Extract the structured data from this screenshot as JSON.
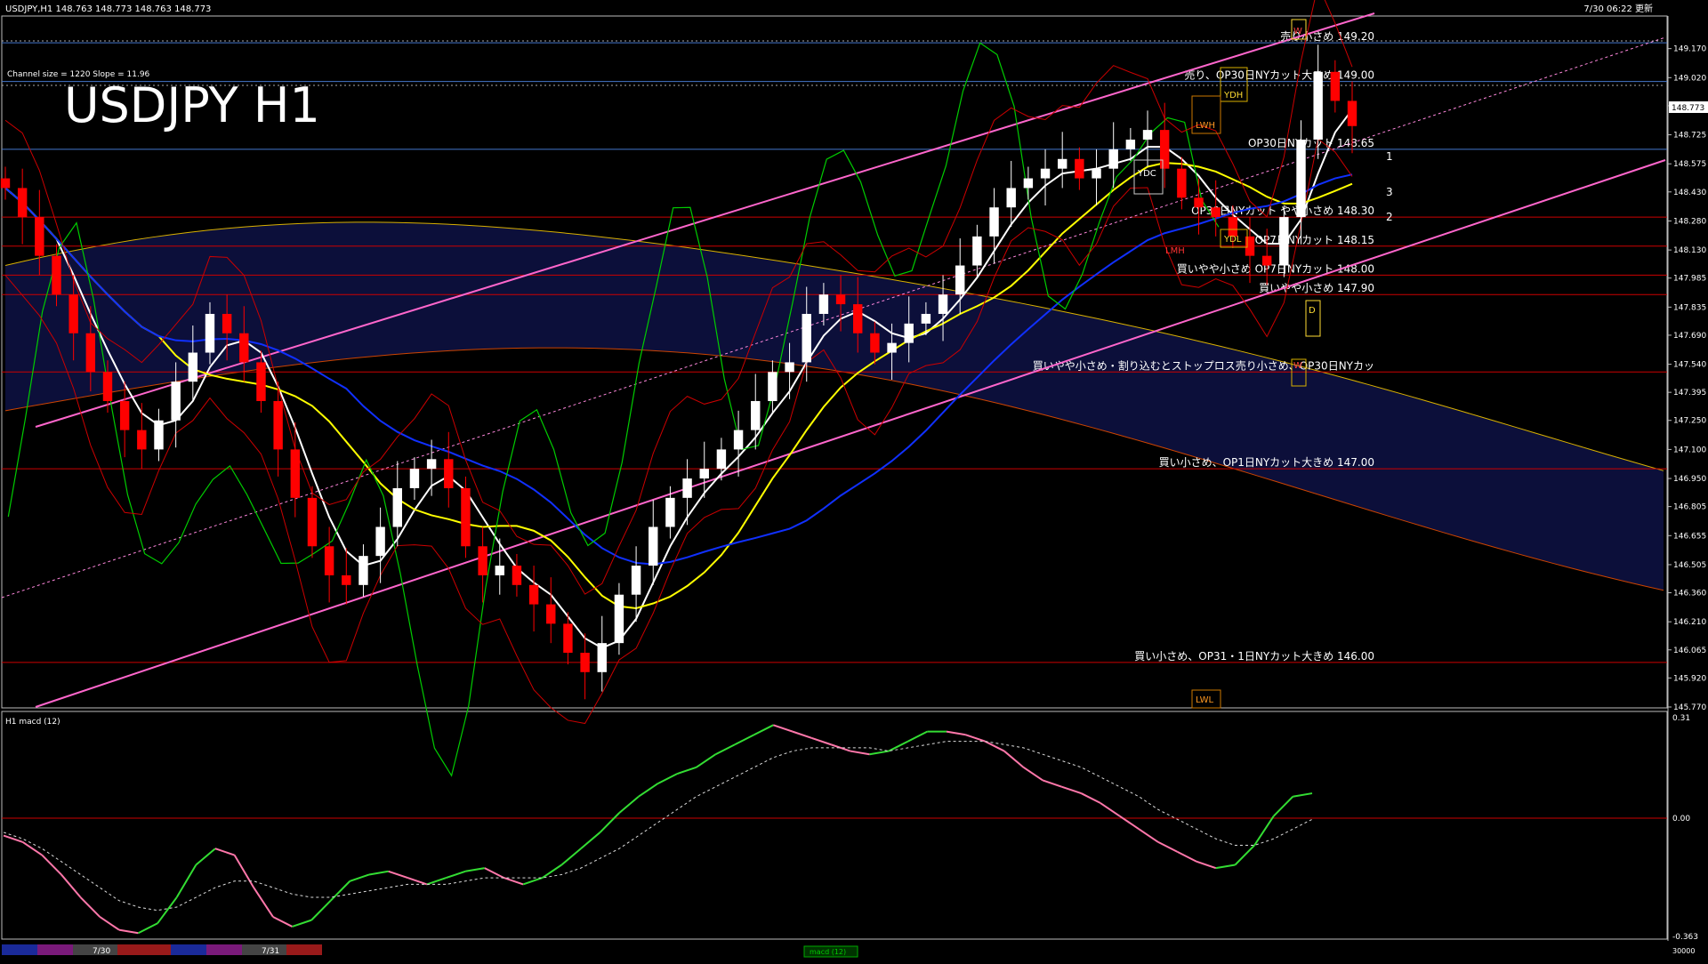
{
  "header": {
    "symbol_info": "USDJPY,H1  148.763 148.773 148.763 148.773",
    "channel_info": "Channel size = 1220 Slope = 11.96",
    "big_title": "USDJPY H1",
    "timestamp": "7/30 06:22 更新"
  },
  "price_axis": {
    "labels": [
      "149.170",
      "149.020",
      "148.875",
      "148.725",
      "148.575",
      "148.430",
      "148.280",
      "148.130",
      "147.985",
      "147.835",
      "147.690",
      "147.540",
      "147.395",
      "147.250",
      "147.100",
      "146.950",
      "146.805",
      "146.655",
      "146.505",
      "146.360",
      "146.210",
      "146.065",
      "145.920",
      "145.770"
    ],
    "current_price": "148.773"
  },
  "levels": [
    {
      "text": "売り小さめ 149.20",
      "value": 149.2
    },
    {
      "text": "売り、OP30日NYカット大きめ 149.00",
      "value": 149.0
    },
    {
      "text": "OP30日NYカット 148.65",
      "value": 148.65
    },
    {
      "text": "OP30日NYカット やや小さめ 148.30",
      "value": 148.3
    },
    {
      "text": "OP7日NYカット 148.15",
      "value": 148.15
    },
    {
      "text": "買いやや小さめ OP7日NYカット 148.00",
      "value": 148.0
    },
    {
      "text": "買いやや小さめ 147.90",
      "value": 147.9
    },
    {
      "text": "買いやや小さめ・割り込むとストップロス売り小さめ、OP30日NYカッ",
      "value": 147.5
    },
    {
      "text": "買い小さめ、OP1日NYカット大きめ 147.00",
      "value": 147.0
    },
    {
      "text": "買い小さめ、OP31・1日NYカット大きめ 146.00",
      "value": 146.0
    }
  ],
  "channel_labels": [
    "1",
    "3",
    "2"
  ],
  "box_labels": [
    "YDH",
    "YDC",
    "YDL",
    "LWH",
    "LWL",
    "LMH",
    "D",
    "W",
    "W"
  ],
  "macd": {
    "title": "H1  macd (12)",
    "axis_labels": [
      "0.31",
      "0.00",
      "-0.363"
    ]
  },
  "bottom_bar": {
    "dates": [
      "7/30",
      "7/31"
    ],
    "tab_label": "macd (12)",
    "right_label": "30000"
  },
  "colors": {
    "background": "#000000",
    "bull_candle": "#ffffff",
    "bear_candle": "#ff0000",
    "ma_white": "#ffffff",
    "ma_yellow": "#ffff00",
    "ma_blue": "#1030ff",
    "channel": "#ff66cc",
    "level_line": "#cc0000",
    "chikou": "#00cc00",
    "macd_up": "#33dd33",
    "macd_down": "#ff77aa"
  },
  "chart_data": {
    "type": "candlestick",
    "symbol": "USDJPY",
    "timeframe": "H1",
    "ylim": [
      145.77,
      149.32
    ],
    "current_price": 148.773,
    "price_series": [
      148.45,
      148.3,
      148.1,
      147.9,
      147.7,
      147.5,
      147.35,
      147.2,
      147.1,
      147.25,
      147.45,
      147.6,
      147.8,
      147.7,
      147.55,
      147.35,
      147.1,
      146.85,
      146.6,
      146.45,
      146.4,
      146.55,
      146.7,
      146.9,
      147.0,
      147.05,
      146.9,
      146.6,
      146.45,
      146.5,
      146.4,
      146.3,
      146.2,
      146.05,
      145.95,
      146.1,
      146.35,
      146.5,
      146.7,
      146.85,
      146.95,
      147.0,
      147.1,
      147.2,
      147.35,
      147.5,
      147.55,
      147.8,
      147.9,
      147.85,
      147.7,
      147.6,
      147.65,
      147.75,
      147.8,
      147.9,
      148.05,
      148.2,
      148.35,
      148.45,
      148.5,
      148.55,
      148.6,
      148.5,
      148.55,
      148.65,
      148.7,
      148.75,
      148.55,
      148.4,
      148.35,
      148.3,
      148.2,
      148.1,
      148.05,
      148.3,
      148.7,
      149.05,
      148.9,
      148.77
    ],
    "macd_ylim": [
      -0.363,
      0.31
    ],
    "macd_series": [
      -0.05,
      -0.07,
      -0.11,
      -0.17,
      -0.24,
      -0.3,
      -0.34,
      -0.35,
      -0.32,
      -0.24,
      -0.14,
      -0.09,
      -0.11,
      -0.21,
      -0.3,
      -0.33,
      -0.31,
      -0.25,
      -0.19,
      -0.17,
      -0.16,
      -0.18,
      -0.2,
      -0.18,
      -0.16,
      -0.15,
      -0.18,
      -0.2,
      -0.18,
      -0.14,
      -0.09,
      -0.04,
      0.02,
      0.07,
      0.11,
      0.14,
      0.16,
      0.2,
      0.23,
      0.26,
      0.29,
      0.27,
      0.25,
      0.23,
      0.21,
      0.2,
      0.21,
      0.24,
      0.27,
      0.27,
      0.26,
      0.24,
      0.21,
      0.16,
      0.12,
      0.1,
      0.08,
      0.05,
      0.01,
      -0.03,
      -0.07,
      -0.1,
      -0.13,
      -0.15,
      -0.14,
      -0.08,
      0.01,
      0.07,
      0.08
    ],
    "macd_signal": [
      -0.04,
      -0.06,
      -0.09,
      -0.13,
      -0.17,
      -0.21,
      -0.25,
      -0.27,
      -0.28,
      -0.27,
      -0.24,
      -0.21,
      -0.19,
      -0.19,
      -0.21,
      -0.23,
      -0.24,
      -0.24,
      -0.23,
      -0.22,
      -0.21,
      -0.2,
      -0.2,
      -0.2,
      -0.19,
      -0.18,
      -0.18,
      -0.18,
      -0.18,
      -0.17,
      -0.15,
      -0.12,
      -0.09,
      -0.05,
      -0.01,
      0.03,
      0.07,
      0.1,
      0.13,
      0.16,
      0.19,
      0.21,
      0.22,
      0.22,
      0.22,
      0.22,
      0.21,
      0.22,
      0.23,
      0.24,
      0.24,
      0.24,
      0.23,
      0.22,
      0.2,
      0.18,
      0.16,
      0.13,
      0.1,
      0.07,
      0.03,
      0.0,
      -0.03,
      -0.06,
      -0.08,
      -0.08,
      -0.06,
      -0.03,
      0.0
    ]
  }
}
